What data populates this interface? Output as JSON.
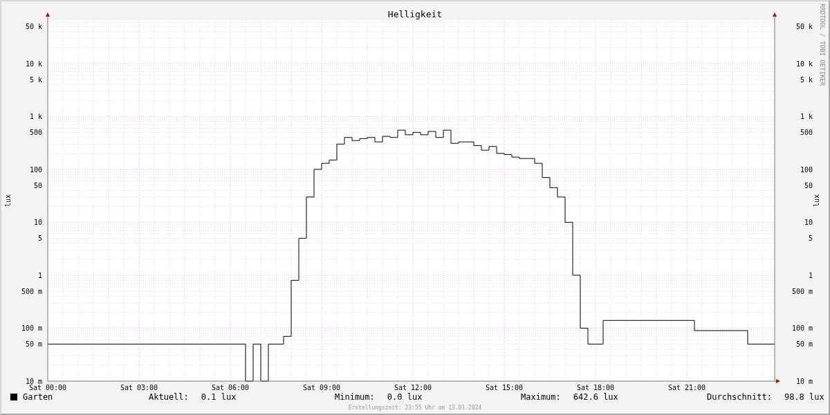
{
  "graph": {
    "title": "Helligkeit",
    "left_axis_title": "lux",
    "right_axis_title": "lux",
    "left_tick_labels": [
      "50 k",
      "10 k",
      "5 k",
      "1 k",
      "500",
      "100",
      "50",
      "10",
      "5",
      "1",
      "500 m",
      "100 m",
      "50 m",
      "10 m"
    ],
    "right_tick_labels": [
      "50 k",
      "10 k",
      "5 k",
      "1 k",
      "500",
      "100",
      "50",
      "10",
      "5",
      "1",
      "500 m",
      "100 m",
      "50 m",
      "10 m"
    ],
    "x_tick_labels": [
      "Sat 00:00",
      "Sat 03:00",
      "Sat 06:00",
      "Sat 09:00",
      "Sat 12:00",
      "Sat 15:00",
      "Sat 18:00",
      "Sat 21:00"
    ],
    "credit": "RRDTOOL / TOBI OETIKER"
  },
  "legend": {
    "series_name": "Garten",
    "stats": [
      {
        "label": "Aktuell:",
        "value": "0.1 lux"
      },
      {
        "label": "Minimum:",
        "value": "0.0 lux"
      },
      {
        "label": "Maximum:",
        "value": "642.6 lux"
      },
      {
        "label": "Durchschnitt:",
        "value": "98.8 lux"
      }
    ]
  },
  "footer": "Erstellungszeit: 23:55 Uhr am 13.01.2024"
}
